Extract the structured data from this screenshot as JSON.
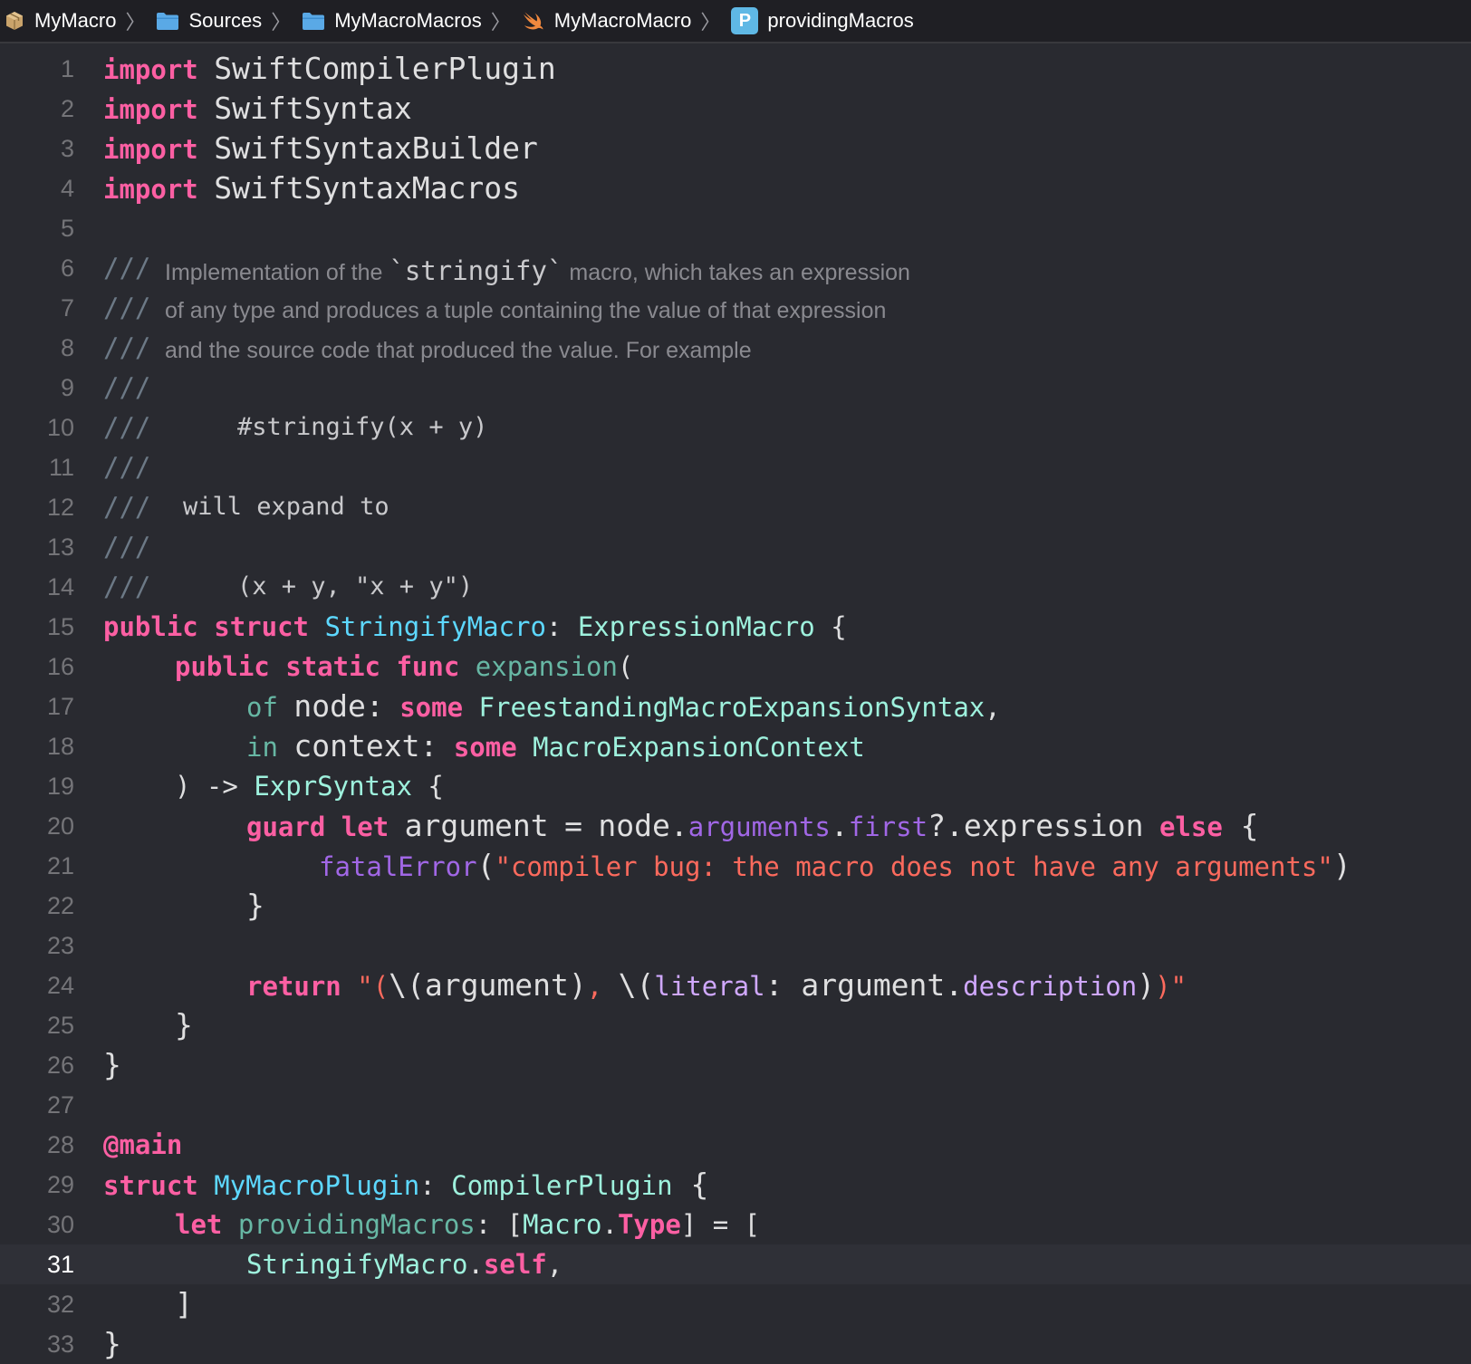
{
  "breadcrumb": {
    "items": [
      {
        "label": "MyMacro",
        "icon": "package-icon"
      },
      {
        "label": "Sources",
        "icon": "folder-icon"
      },
      {
        "label": "MyMacroMacros",
        "icon": "folder-icon"
      },
      {
        "label": "MyMacroMacro",
        "icon": "swift-icon"
      },
      {
        "label": "providingMacros",
        "icon": "property-icon",
        "badge": "P"
      }
    ],
    "separator": "〉"
  },
  "editor": {
    "current_line": 31,
    "line_numbers": [
      "1",
      "2",
      "3",
      "4",
      "5",
      "6",
      "7",
      "8",
      "9",
      "10",
      "11",
      "12",
      "13",
      "14",
      "15",
      "16",
      "17",
      "18",
      "19",
      "20",
      "21",
      "22",
      "23",
      "24",
      "25",
      "26",
      "27",
      "28",
      "29",
      "30",
      "31",
      "32",
      "33"
    ],
    "code": {
      "import_kw": "import",
      "mod1": "SwiftCompilerPlugin",
      "mod2": "SwiftSyntax",
      "mod3": "SwiftSyntaxBuilder",
      "mod4": "SwiftSyntaxMacros",
      "doc_slashes": "///",
      "doc6a": "Implementation of the ",
      "doc6b": "`stringify`",
      "doc6c": " macro, which takes an expression",
      "doc7": "of any type and produces a tuple containing the value of that expression",
      "doc8": "and the source code that produced the value. For example",
      "doc10": "#stringify(x + y)",
      "doc12": "will expand to",
      "doc14": "(x + y, \"x + y\")",
      "public_kw": "public",
      "struct_kw": "struct",
      "static_kw": "static",
      "func_kw": "func",
      "some_kw": "some",
      "guard_kw": "guard",
      "let_kw": "let",
      "else_kw": "else",
      "return_kw": "return",
      "of_label": "of",
      "in_label": "in",
      "stringify_macro": "StringifyMacro",
      "expression_macro": "ExpressionMacro",
      "expansion": "expansion",
      "node": "node",
      "context": "context",
      "freestanding": "FreestandingMacroExpansionSyntax",
      "macro_ctx": "MacroExpansionContext",
      "arrow": ") ->",
      "expr_syntax": "ExprSyntax",
      "argument": "argument",
      "equals": "=",
      "node_dot": "node.",
      "arguments": "arguments",
      "first": "first",
      "optional_expr": "?.expression",
      "fatal_error": "fatalError",
      "fatal_msg": "\"compiler bug: the macro does not have any arguments\"",
      "ret_q1": "\"(",
      "ret_interp1": "\\(argument)",
      "ret_comma": ", ",
      "ret_interp2_open": "\\(",
      "literal": "literal",
      "ret_colon": ": ",
      "ret_arg": "argument.",
      "description": "description",
      "ret_close": ")",
      "ret_q2": ")\"",
      "at_main": "@main",
      "my_plugin": "MyMacroPlugin",
      "compiler_plugin": "CompilerPlugin",
      "providing_macros": "providingMacros",
      "macro_type_a": "Macro",
      "macro_type_b": "Type",
      "stringify_self_a": "StringifyMacro",
      "stringify_self_b": "self"
    }
  },
  "colors": {
    "background": "#292a30",
    "keyword": "#fc5fa3",
    "type_decl": "#5dd8ff",
    "type_ref": "#9ef1dd",
    "function_decl": "#67b7a4",
    "member": "#a167e6",
    "string": "#fc6a5d",
    "comment": "#6c7986"
  }
}
